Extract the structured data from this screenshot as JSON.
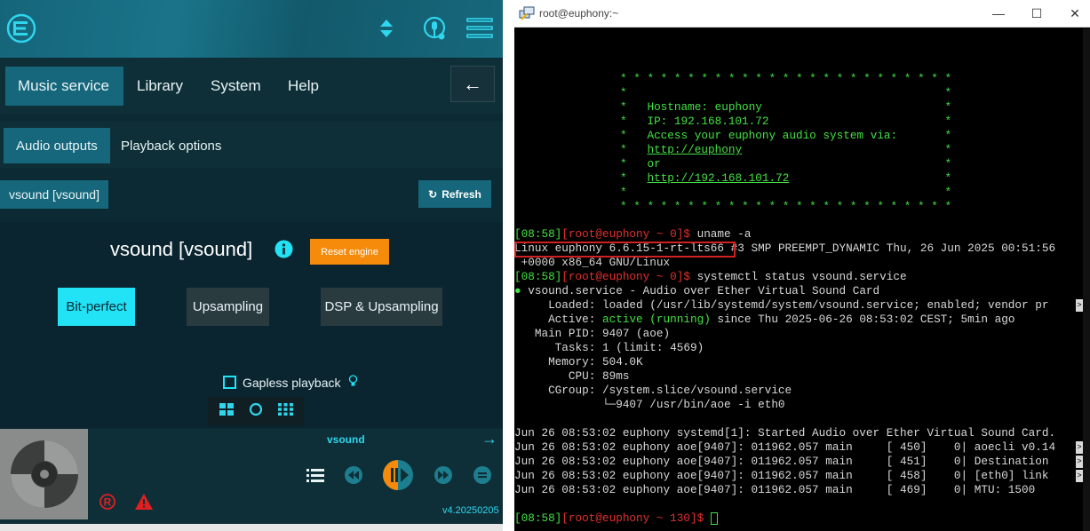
{
  "app": {
    "main_nav": [
      "Music service",
      "Library",
      "System",
      "Help"
    ],
    "sub_nav": [
      "Audio outputs",
      "Playback options"
    ],
    "device_label": "vsound [vsound]",
    "refresh_label": "Refresh",
    "engine_title": "vsound [vsound]",
    "reset_label": "Reset engine",
    "modes": [
      "Bit-perfect",
      "Upsampling",
      "DSP & Upsampling"
    ],
    "active_mode": "Bit-perfect",
    "gapless_label": "Gapless playback",
    "track_title": "vsound",
    "version": "v4.20250205",
    "accent_color": "#22e2f6",
    "warn_color": "#f58a0b"
  },
  "terminal": {
    "window_title": "root@euphony:~",
    "banner": [
      "* * * * * * * * * * * * * * * * * * * * * * * * *",
      "*                                               *",
      "*   Hostname: euphony                           *",
      "*   IP: 192.168.101.72                          *",
      "*   Access your euphony audio system via:       *",
      "*   http://euphony                              *",
      "*   or                                          *",
      "*   http://192.168.101.72                       *",
      "*                                               *",
      "* * * * * * * * * * * * * * * * * * * * * * * * *"
    ],
    "prompt1_time": "[08:58]",
    "prompt_user": "[root@euphony ~ 0]$",
    "cmd1": " uname -a",
    "uname_highlight": "Linux euphony 6.6.15-1-rt-lts66",
    "uname_rest": " #3 SMP PREEMPT_DYNAMIC Thu, 26 Jun 2025 00:51:56",
    "uname_line2": " +0000 x86_64 GNU/Linux",
    "cmd2": " systemctl status vsound.service",
    "service_header": "vsound.service - Audio over Ether Virtual Sound Card",
    "loaded": "     Loaded: loaded (/usr/lib/systemd/system/vsound.service; enabled; vendor pr",
    "active_prefix": "     Active: ",
    "active_state": "active (running)",
    "active_suffix": " since Thu 2025-06-26 08:53:02 CEST; 5min ago",
    "main_pid": "   Main PID: 9407 (aoe)",
    "tasks": "      Tasks: 1 (limit: 4569)",
    "memory": "     Memory: 504.0K",
    "cpu": "        CPU: 89ms",
    "cgroup": "     CGroup: /system.slice/vsound.service",
    "cgroup_child": "             └─9407 /usr/bin/aoe -i eth0",
    "logs": [
      "Jun 26 08:53:02 euphony systemd[1]: Started Audio over Ether Virtual Sound Card.",
      "Jun 26 08:53:02 euphony aoe[9407]: 011962.057 main     [ 450]    0| aoecli v0.14",
      "Jun 26 08:53:02 euphony aoe[9407]: 011962.057 main     [ 451]    0| Destination",
      "Jun 26 08:53:02 euphony aoe[9407]: 011962.057 main     [ 458]    0| [eth0] link",
      "Jun 26 08:53:02 euphony aoe[9407]: 011962.057 main     [ 469]    0| MTU: 1500"
    ],
    "prompt_last_user": "[root@euphony ~ 130]$"
  }
}
